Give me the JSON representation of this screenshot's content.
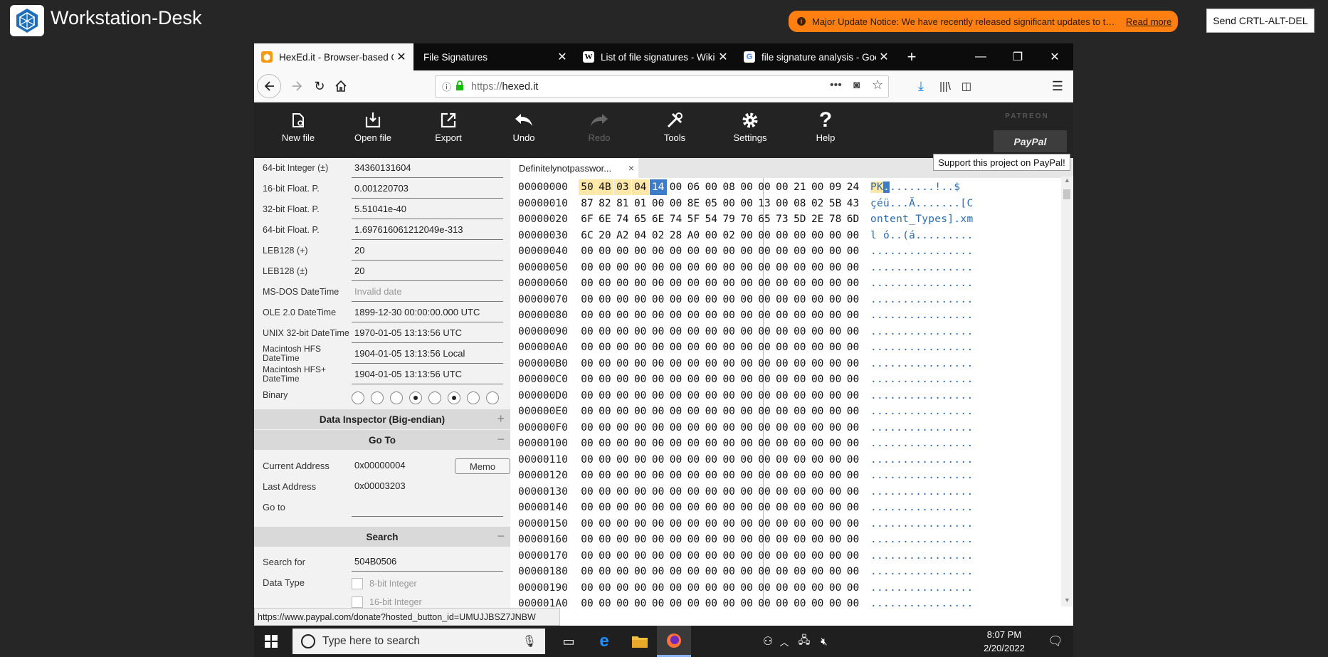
{
  "app": {
    "title": "Workstation-Desk",
    "notice": "Major Update Notice: We have recently released significant updates to the NICE Challenge...",
    "notice_link": "Read more",
    "cad_button": "Send CRTL-ALT-DEL"
  },
  "browser": {
    "tabs": [
      {
        "label": "HexEd.it - Browser-based Online",
        "icon": "hexedit-icon",
        "active": true
      },
      {
        "label": "File Signatures",
        "icon": "",
        "active": false
      },
      {
        "label": "List of file signatures - Wikipedia",
        "icon": "wikipedia-icon",
        "active": false
      },
      {
        "label": "file signature analysis - Google",
        "icon": "google-icon",
        "active": false
      }
    ],
    "new_tab": "+",
    "url_scheme": "https://",
    "url_host": "hexed.it",
    "status_url": "https://www.paypal.com/donate?hosted_button_id=UMUJJBSZ7JNBW"
  },
  "toolbar": {
    "new_file": "New file",
    "open_file": "Open file",
    "export": "Export",
    "undo": "Undo",
    "redo": "Redo",
    "tools": "Tools",
    "settings": "Settings",
    "help": "Help",
    "patreon": "PATREON",
    "paypal": "PayPal",
    "paypal_tooltip": "Support this project on PayPal!"
  },
  "inspector": {
    "rows": [
      {
        "label": "64-bit Integer (±)",
        "value": "34360131604"
      },
      {
        "label": "16-bit Float. P.",
        "value": "0.001220703"
      },
      {
        "label": "32-bit Float. P.",
        "value": "5.51041e-40"
      },
      {
        "label": "64-bit Float. P.",
        "value": "1.697616061212049e-313"
      },
      {
        "label": "LEB128 (+)",
        "value": "20"
      },
      {
        "label": "LEB128 (±)",
        "value": "20"
      },
      {
        "label": "MS-DOS DateTime",
        "value": "Invalid date"
      },
      {
        "label": "OLE 2.0 DateTime",
        "value": "1899-12-30 00:00:00.000 UTC"
      },
      {
        "label": "UNIX 32-bit DateTime",
        "value": "1970-01-05 13:13:56 UTC"
      },
      {
        "label": "Macintosh HFS DateTime",
        "value": "1904-01-05 13:13:56 Local"
      },
      {
        "label": "Macintosh HFS+ DateTime",
        "value": "1904-01-05 13:13:56 UTC"
      }
    ],
    "binary_label": "Binary",
    "binary_bits": [
      0,
      0,
      0,
      1,
      0,
      1,
      0,
      0
    ],
    "section_title": "Data Inspector (Big-endian)",
    "section_toggle": "+"
  },
  "goto": {
    "title": "Go To",
    "toggle": "−",
    "current_label": "Current Address",
    "current_value": "0x00000004",
    "memo": "Memo",
    "last_label": "Last Address",
    "last_value": "0x00003203",
    "goto_label": "Go to",
    "goto_value": ""
  },
  "search": {
    "title": "Search",
    "toggle": "−",
    "search_label": "Search for",
    "search_value": "504B0506",
    "type_label": "Data Type",
    "type_opt1": "8-bit Integer",
    "type_opt2": "16-bit Integer"
  },
  "file_tab": {
    "label": "Definitelynotpasswor...",
    "close": "×"
  },
  "hex": {
    "rows": [
      {
        "addr": "00000000",
        "bytes": [
          "50",
          "4B",
          "03",
          "04",
          "14",
          "00",
          "06",
          "00",
          "08",
          "00",
          "00",
          "00",
          "21",
          "00",
          "09",
          "24"
        ],
        "ascii": "PK........!..$"
      },
      {
        "addr": "00000010",
        "bytes": [
          "87",
          "82",
          "81",
          "01",
          "00",
          "00",
          "8E",
          "05",
          "00",
          "00",
          "13",
          "00",
          "08",
          "02",
          "5B",
          "43"
        ],
        "ascii": "çéü...Ä.......[C"
      },
      {
        "addr": "00000020",
        "bytes": [
          "6F",
          "6E",
          "74",
          "65",
          "6E",
          "74",
          "5F",
          "54",
          "79",
          "70",
          "65",
          "73",
          "5D",
          "2E",
          "78",
          "6D"
        ],
        "ascii": "ontent_Types].xm"
      },
      {
        "addr": "00000030",
        "bytes": [
          "6C",
          "20",
          "A2",
          "04",
          "02",
          "28",
          "A0",
          "00",
          "02",
          "00",
          "00",
          "00",
          "00",
          "00",
          "00",
          "00"
        ],
        "ascii": "l ó..(á........."
      },
      {
        "addr": "00000040",
        "bytes": [
          "00",
          "00",
          "00",
          "00",
          "00",
          "00",
          "00",
          "00",
          "00",
          "00",
          "00",
          "00",
          "00",
          "00",
          "00",
          "00"
        ],
        "ascii": "................"
      },
      {
        "addr": "00000050",
        "bytes": [
          "00",
          "00",
          "00",
          "00",
          "00",
          "00",
          "00",
          "00",
          "00",
          "00",
          "00",
          "00",
          "00",
          "00",
          "00",
          "00"
        ],
        "ascii": "................"
      },
      {
        "addr": "00000060",
        "bytes": [
          "00",
          "00",
          "00",
          "00",
          "00",
          "00",
          "00",
          "00",
          "00",
          "00",
          "00",
          "00",
          "00",
          "00",
          "00",
          "00"
        ],
        "ascii": "................"
      },
      {
        "addr": "00000070",
        "bytes": [
          "00",
          "00",
          "00",
          "00",
          "00",
          "00",
          "00",
          "00",
          "00",
          "00",
          "00",
          "00",
          "00",
          "00",
          "00",
          "00"
        ],
        "ascii": "................"
      },
      {
        "addr": "00000080",
        "bytes": [
          "00",
          "00",
          "00",
          "00",
          "00",
          "00",
          "00",
          "00",
          "00",
          "00",
          "00",
          "00",
          "00",
          "00",
          "00",
          "00"
        ],
        "ascii": "................"
      },
      {
        "addr": "00000090",
        "bytes": [
          "00",
          "00",
          "00",
          "00",
          "00",
          "00",
          "00",
          "00",
          "00",
          "00",
          "00",
          "00",
          "00",
          "00",
          "00",
          "00"
        ],
        "ascii": "................"
      },
      {
        "addr": "000000A0",
        "bytes": [
          "00",
          "00",
          "00",
          "00",
          "00",
          "00",
          "00",
          "00",
          "00",
          "00",
          "00",
          "00",
          "00",
          "00",
          "00",
          "00"
        ],
        "ascii": "................"
      },
      {
        "addr": "000000B0",
        "bytes": [
          "00",
          "00",
          "00",
          "00",
          "00",
          "00",
          "00",
          "00",
          "00",
          "00",
          "00",
          "00",
          "00",
          "00",
          "00",
          "00"
        ],
        "ascii": "................"
      },
      {
        "addr": "000000C0",
        "bytes": [
          "00",
          "00",
          "00",
          "00",
          "00",
          "00",
          "00",
          "00",
          "00",
          "00",
          "00",
          "00",
          "00",
          "00",
          "00",
          "00"
        ],
        "ascii": "................"
      },
      {
        "addr": "000000D0",
        "bytes": [
          "00",
          "00",
          "00",
          "00",
          "00",
          "00",
          "00",
          "00",
          "00",
          "00",
          "00",
          "00",
          "00",
          "00",
          "00",
          "00"
        ],
        "ascii": "................"
      },
      {
        "addr": "000000E0",
        "bytes": [
          "00",
          "00",
          "00",
          "00",
          "00",
          "00",
          "00",
          "00",
          "00",
          "00",
          "00",
          "00",
          "00",
          "00",
          "00",
          "00"
        ],
        "ascii": "................"
      },
      {
        "addr": "000000F0",
        "bytes": [
          "00",
          "00",
          "00",
          "00",
          "00",
          "00",
          "00",
          "00",
          "00",
          "00",
          "00",
          "00",
          "00",
          "00",
          "00",
          "00"
        ],
        "ascii": "................"
      },
      {
        "addr": "00000100",
        "bytes": [
          "00",
          "00",
          "00",
          "00",
          "00",
          "00",
          "00",
          "00",
          "00",
          "00",
          "00",
          "00",
          "00",
          "00",
          "00",
          "00"
        ],
        "ascii": "................"
      },
      {
        "addr": "00000110",
        "bytes": [
          "00",
          "00",
          "00",
          "00",
          "00",
          "00",
          "00",
          "00",
          "00",
          "00",
          "00",
          "00",
          "00",
          "00",
          "00",
          "00"
        ],
        "ascii": "................"
      },
      {
        "addr": "00000120",
        "bytes": [
          "00",
          "00",
          "00",
          "00",
          "00",
          "00",
          "00",
          "00",
          "00",
          "00",
          "00",
          "00",
          "00",
          "00",
          "00",
          "00"
        ],
        "ascii": "................"
      },
      {
        "addr": "00000130",
        "bytes": [
          "00",
          "00",
          "00",
          "00",
          "00",
          "00",
          "00",
          "00",
          "00",
          "00",
          "00",
          "00",
          "00",
          "00",
          "00",
          "00"
        ],
        "ascii": "................"
      },
      {
        "addr": "00000140",
        "bytes": [
          "00",
          "00",
          "00",
          "00",
          "00",
          "00",
          "00",
          "00",
          "00",
          "00",
          "00",
          "00",
          "00",
          "00",
          "00",
          "00"
        ],
        "ascii": "................"
      },
      {
        "addr": "00000150",
        "bytes": [
          "00",
          "00",
          "00",
          "00",
          "00",
          "00",
          "00",
          "00",
          "00",
          "00",
          "00",
          "00",
          "00",
          "00",
          "00",
          "00"
        ],
        "ascii": "................"
      },
      {
        "addr": "00000160",
        "bytes": [
          "00",
          "00",
          "00",
          "00",
          "00",
          "00",
          "00",
          "00",
          "00",
          "00",
          "00",
          "00",
          "00",
          "00",
          "00",
          "00"
        ],
        "ascii": "................"
      },
      {
        "addr": "00000170",
        "bytes": [
          "00",
          "00",
          "00",
          "00",
          "00",
          "00",
          "00",
          "00",
          "00",
          "00",
          "00",
          "00",
          "00",
          "00",
          "00",
          "00"
        ],
        "ascii": "................"
      },
      {
        "addr": "00000180",
        "bytes": [
          "00",
          "00",
          "00",
          "00",
          "00",
          "00",
          "00",
          "00",
          "00",
          "00",
          "00",
          "00",
          "00",
          "00",
          "00",
          "00"
        ],
        "ascii": "................"
      },
      {
        "addr": "00000190",
        "bytes": [
          "00",
          "00",
          "00",
          "00",
          "00",
          "00",
          "00",
          "00",
          "00",
          "00",
          "00",
          "00",
          "00",
          "00",
          "00",
          "00"
        ],
        "ascii": "................"
      },
      {
        "addr": "000001A0",
        "bytes": [
          "00",
          "00",
          "00",
          "00",
          "00",
          "00",
          "00",
          "00",
          "00",
          "00",
          "00",
          "00",
          "00",
          "00",
          "00",
          "00"
        ],
        "ascii": "................"
      }
    ],
    "selected_bytes": [
      0,
      1,
      2,
      3
    ],
    "cursor_byte": 4
  },
  "taskbar": {
    "search_placeholder": "Type here to search",
    "time": "8:07 PM",
    "date": "2/20/2022"
  },
  "colors": {
    "notice": "#ff7f11",
    "hex_selection": "#ffe7a8",
    "hex_cursor": "#3d7cc9",
    "ascii_text": "#2b6bb3"
  }
}
